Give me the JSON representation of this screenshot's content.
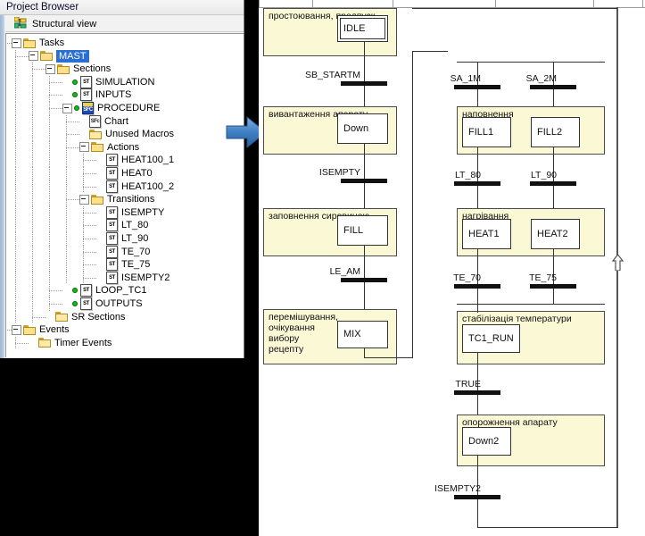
{
  "browser": {
    "title": "Project Browser",
    "view_label": "Structural view",
    "view_icon": "structural-view-icon",
    "tree": [
      {
        "label": "Tasks",
        "icon": "folder-open-icon",
        "depth": 1,
        "expander": "minus",
        "selected": false
      },
      {
        "label": "MAST",
        "icon": "folder-open-icon",
        "depth": 2,
        "expander": "minus",
        "selected": true
      },
      {
        "label": "Sections",
        "icon": "folder-open-icon",
        "depth": 3,
        "expander": "minus",
        "selected": false
      },
      {
        "label": "SIMULATION",
        "icon": "st-section-icon",
        "depth": 4,
        "expander": "none",
        "selected": false,
        "dot": true
      },
      {
        "label": "INPUTS",
        "icon": "st-section-icon",
        "depth": 4,
        "expander": "none",
        "selected": false,
        "dot": true
      },
      {
        "label": "PROCEDURE",
        "icon": "sfc-section-icon",
        "depth": 4,
        "expander": "minus",
        "selected": false,
        "dot": true
      },
      {
        "label": "Chart",
        "icon": "sfc-chart-icon",
        "depth": 5,
        "expander": "none",
        "selected": false
      },
      {
        "label": "Unused Macros",
        "icon": "folder-icon",
        "depth": 5,
        "expander": "none",
        "selected": false
      },
      {
        "label": "Actions",
        "icon": "folder-open-icon",
        "depth": 5,
        "expander": "minus",
        "selected": false
      },
      {
        "label": "HEAT100_1",
        "icon": "st-section-icon",
        "depth": 6,
        "expander": "none",
        "selected": false
      },
      {
        "label": "HEAT0",
        "icon": "st-section-icon",
        "depth": 6,
        "expander": "none",
        "selected": false
      },
      {
        "label": "HEAT100_2",
        "icon": "st-section-icon",
        "depth": 6,
        "expander": "none",
        "selected": false
      },
      {
        "label": "Transitions",
        "icon": "folder-open-icon",
        "depth": 5,
        "expander": "minus",
        "selected": false
      },
      {
        "label": "ISEMPTY",
        "icon": "st-section-icon",
        "depth": 6,
        "expander": "none",
        "selected": false
      },
      {
        "label": "LT_80",
        "icon": "st-section-icon",
        "depth": 6,
        "expander": "none",
        "selected": false
      },
      {
        "label": "LT_90",
        "icon": "st-section-icon",
        "depth": 6,
        "expander": "none",
        "selected": false
      },
      {
        "label": "TE_70",
        "icon": "st-section-icon",
        "depth": 6,
        "expander": "none",
        "selected": false
      },
      {
        "label": "TE_75",
        "icon": "st-section-icon",
        "depth": 6,
        "expander": "none",
        "selected": false
      },
      {
        "label": "ISEMPTY2",
        "icon": "st-section-icon",
        "depth": 6,
        "expander": "none",
        "selected": false
      },
      {
        "label": "LOOP_TC1",
        "icon": "st-section-icon",
        "depth": 4,
        "expander": "none",
        "selected": false,
        "dot": true
      },
      {
        "label": "OUTPUTS",
        "icon": "st-section-icon",
        "depth": 4,
        "expander": "none",
        "selected": false,
        "dot": true
      },
      {
        "label": "SR Sections",
        "icon": "folder-icon",
        "depth": 3,
        "expander": "none",
        "selected": false
      },
      {
        "label": "Events",
        "icon": "folder-open-icon",
        "depth": 1,
        "expander": "minus",
        "selected": false
      },
      {
        "label": "Timer Events",
        "icon": "folder-icon",
        "depth": 2,
        "expander": "none",
        "selected": false
      }
    ]
  },
  "annotation": {
    "arrow_icon": "blue-right-arrow-icon"
  },
  "chart": {
    "macros": [
      {
        "id": "m-idle",
        "caption": "простоювання, предпуск"
      },
      {
        "id": "m-down",
        "caption": "вивантаження апарату"
      },
      {
        "id": "m-fill",
        "caption": "заповнення сировиною"
      },
      {
        "id": "m-mix",
        "caption": "перемішування,\nочікування\nвибору\nрецепту"
      },
      {
        "id": "m-napov",
        "caption": "наповнення"
      },
      {
        "id": "m-nagriv",
        "caption": "нагрівання"
      },
      {
        "id": "m-stab",
        "caption": "стабілізація температури"
      },
      {
        "id": "m-oporoj",
        "caption": "опорожнення апарату"
      }
    ],
    "steps": [
      {
        "id": "s-idle",
        "name": "IDLE",
        "initial": true
      },
      {
        "id": "s-down",
        "name": "Down",
        "initial": false
      },
      {
        "id": "s-fill",
        "name": "FILL",
        "initial": false
      },
      {
        "id": "s-mix",
        "name": "MIX",
        "initial": false
      },
      {
        "id": "s-fill1",
        "name": "FILL1",
        "initial": false
      },
      {
        "id": "s-fill2",
        "name": "FILL2",
        "initial": false
      },
      {
        "id": "s-heat1",
        "name": "HEAT1",
        "initial": false
      },
      {
        "id": "s-heat2",
        "name": "HEAT2",
        "initial": false
      },
      {
        "id": "s-tc1run",
        "name": "TC1_RUN",
        "initial": false
      },
      {
        "id": "s-down2",
        "name": "Down2",
        "initial": false
      }
    ],
    "transitions": [
      {
        "id": "t-start",
        "name": "SB_STARTM"
      },
      {
        "id": "t-isempty",
        "name": "ISEMPTY"
      },
      {
        "id": "t-leam",
        "name": "LE_AM"
      },
      {
        "id": "t-sa1m",
        "name": "SA_1M"
      },
      {
        "id": "t-sa2m",
        "name": "SA_2M"
      },
      {
        "id": "t-lt80",
        "name": "LT_80"
      },
      {
        "id": "t-lt90",
        "name": "LT_90"
      },
      {
        "id": "t-te70",
        "name": "TE_70"
      },
      {
        "id": "t-te75",
        "name": "TE_75"
      },
      {
        "id": "t-true",
        "name": "TRUE"
      },
      {
        "id": "t-isempty2",
        "name": "ISEMPTY2"
      }
    ]
  }
}
